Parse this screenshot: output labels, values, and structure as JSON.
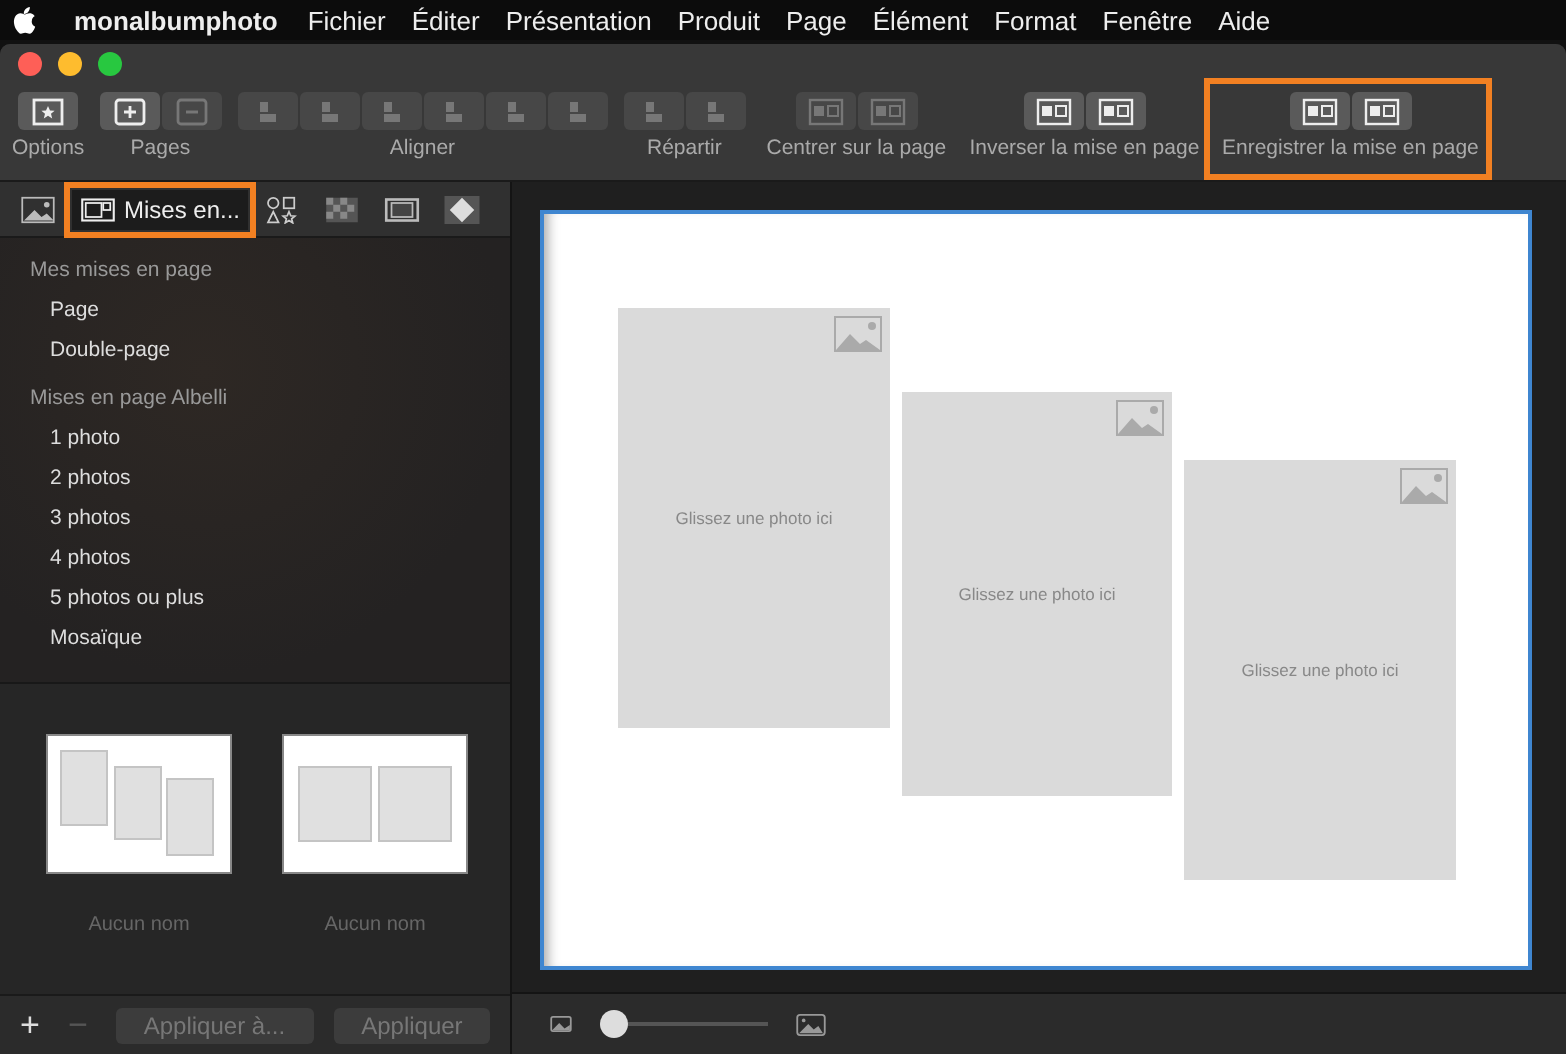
{
  "menu_bar": {
    "app_name": "monalbumphoto",
    "items": [
      "Fichier",
      "Éditer",
      "Présentation",
      "Produit",
      "Page",
      "Élément",
      "Format",
      "Fenêtre",
      "Aide"
    ]
  },
  "toolbar": {
    "groups": [
      {
        "label": "Options",
        "highlighted": false,
        "buttons": [
          {
            "kind": "options",
            "disabled": false
          }
        ]
      },
      {
        "label": "Pages",
        "highlighted": false,
        "buttons": [
          {
            "kind": "add",
            "disabled": false
          },
          {
            "kind": "remove",
            "disabled": true
          }
        ]
      },
      {
        "label": "Aligner",
        "highlighted": false,
        "buttons": [
          {
            "kind": "align-left",
            "disabled": true
          },
          {
            "kind": "align-center",
            "disabled": true
          },
          {
            "kind": "align-right",
            "disabled": true
          },
          {
            "kind": "align-top",
            "disabled": true
          },
          {
            "kind": "align-middle",
            "disabled": true
          },
          {
            "kind": "align-bottom",
            "disabled": true
          }
        ]
      },
      {
        "label": "Répartir",
        "highlighted": false,
        "buttons": [
          {
            "kind": "distribute-h",
            "disabled": true
          },
          {
            "kind": "distribute-v",
            "disabled": true
          }
        ]
      },
      {
        "label": "Centrer sur la page",
        "highlighted": false,
        "buttons": [
          {
            "kind": "center-v",
            "disabled": true
          },
          {
            "kind": "center-h",
            "disabled": true
          }
        ]
      },
      {
        "label": "Inverser la mise en page",
        "highlighted": false,
        "buttons": [
          {
            "kind": "flip-left",
            "disabled": false
          },
          {
            "kind": "flip-both",
            "disabled": false
          }
        ]
      },
      {
        "label": "Enregistrer la mise en page",
        "highlighted": true,
        "buttons": [
          {
            "kind": "save-page",
            "disabled": false
          },
          {
            "kind": "save-spread",
            "disabled": false
          }
        ]
      }
    ]
  },
  "side_tabs": [
    {
      "kind": "photos",
      "selected": false,
      "highlighted": false
    },
    {
      "kind": "layouts",
      "label": "Mises en...",
      "selected": true,
      "highlighted": true
    },
    {
      "kind": "shapes",
      "selected": false,
      "highlighted": false
    },
    {
      "kind": "backgrounds",
      "selected": false,
      "highlighted": false
    },
    {
      "kind": "frames",
      "selected": false,
      "highlighted": false
    },
    {
      "kind": "stickers",
      "selected": false,
      "highlighted": false
    }
  ],
  "layout_sections": [
    {
      "title": "Mes mises en page",
      "items": [
        "Page",
        "Double-page"
      ]
    },
    {
      "title": "Mises en page Albelli",
      "items": [
        "1 photo",
        "2 photos",
        "3 photos",
        "4 photos",
        "5 photos ou plus",
        "Mosaïque"
      ]
    }
  ],
  "thumbnails": [
    {
      "kind": "three-staggered",
      "name": "Aucun nom"
    },
    {
      "kind": "two-side",
      "name": "Aucun nom"
    }
  ],
  "panel_actions": [
    {
      "kind": "add",
      "label": "+",
      "disabled": false
    },
    {
      "kind": "remove",
      "label": "−",
      "disabled": true
    },
    {
      "kind": "button",
      "label": "Appliquer à...",
      "disabled": true
    },
    {
      "kind": "button",
      "label": "Appliquer",
      "disabled": true
    }
  ],
  "page": {
    "slots": [
      {
        "hint": "Glissez une photo ici"
      },
      {
        "hint": "Glissez une photo ici"
      },
      {
        "hint": "Glissez une photo ici"
      }
    ]
  },
  "zoom": {
    "level": 0
  }
}
